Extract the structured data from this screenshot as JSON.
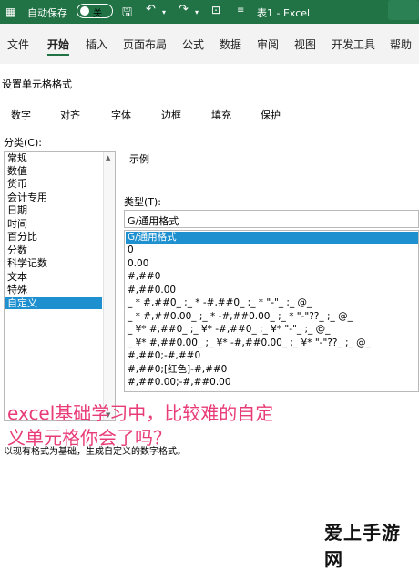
{
  "titlebar": {
    "autosave_label": "自动保存",
    "autosave_state": "关",
    "doc_title": "表1 - Excel"
  },
  "ribbon": {
    "tabs": [
      "文件",
      "开始",
      "插入",
      "页面布局",
      "公式",
      "数据",
      "审阅",
      "视图",
      "开发工具",
      "帮助"
    ],
    "active_tab": "开始"
  },
  "dialog": {
    "title": "设置单元格格式",
    "tabs": [
      "数字",
      "对齐",
      "字体",
      "边框",
      "填充",
      "保护"
    ],
    "category_label": "分类(C):",
    "categories": [
      "常规",
      "数值",
      "货币",
      "会计专用",
      "日期",
      "时间",
      "百分比",
      "分数",
      "科学记数",
      "文本",
      "特殊",
      "自定义"
    ],
    "selected_category": "自定义",
    "sample_label": "示例",
    "type_label": "类型(T):",
    "type_value": "G/通用格式",
    "formats": [
      "G/通用格式",
      "0",
      "0.00",
      "#,##0",
      "#,##0.00",
      "_ * #,##0_ ;_ * -#,##0_ ;_ * \"-\"_ ;_ @_",
      "_ * #,##0.00_ ;_ * -#,##0.00_ ;_ * \"-\"??_ ;_ @_",
      "_ ¥* #,##0_ ;_ ¥* -#,##0_ ;_ ¥* \"-\"_ ;_ @_",
      "_ ¥* #,##0.00_ ;_ ¥* -#,##0.00_ ;_ ¥* \"-\"??_ ;_ @_",
      "#,##0;-#,##0",
      "#,##0;[红色]-#,##0",
      "#,##0.00;-#,##0.00"
    ],
    "selected_format": "G/通用格式",
    "description": "以现有格式为基础，生成自定义的数字格式。"
  },
  "caption": {
    "line1": "excel基础学习中，比较难的自定",
    "line2": "义单元格你会了吗？"
  },
  "watermark": "爱上手游网",
  "colors": {
    "excel_green": "#217346",
    "selection": "#1e90cf",
    "caption": "#e83c78"
  }
}
